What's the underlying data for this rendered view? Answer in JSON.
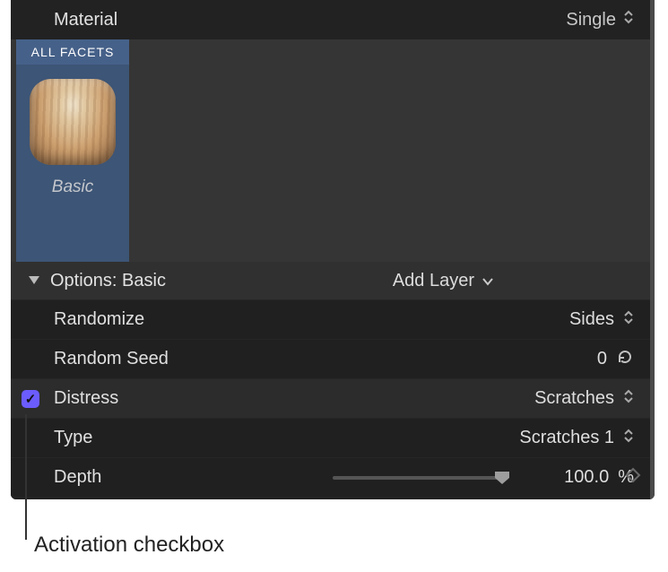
{
  "header": {
    "material_label": "Material",
    "material_mode": "Single"
  },
  "facets": {
    "tab_label": "ALL FACETS",
    "selected_name": "Basic"
  },
  "options": {
    "title": "Options: Basic",
    "add_layer_label": "Add Layer"
  },
  "rows": {
    "randomize": {
      "label": "Randomize",
      "value": "Sides"
    },
    "random_seed": {
      "label": "Random Seed",
      "value": "0"
    },
    "distress": {
      "label": "Distress",
      "value": "Scratches",
      "checked": true
    },
    "type": {
      "label": "Type",
      "value": "Scratches 1"
    },
    "depth": {
      "label": "Depth",
      "value": "100.0",
      "unit": "%"
    }
  },
  "callout": {
    "text": "Activation checkbox"
  },
  "icons": {
    "stepper": "stepper-updown-icon",
    "chevron_down": "chevron-down-icon",
    "disclosure": "disclosure-triangle-icon",
    "refresh": "refresh-icon",
    "keyframe": "keyframe-diamond-icon",
    "slider_thumb": "slider-thumb-icon",
    "checkmark": "checkmark-icon"
  }
}
